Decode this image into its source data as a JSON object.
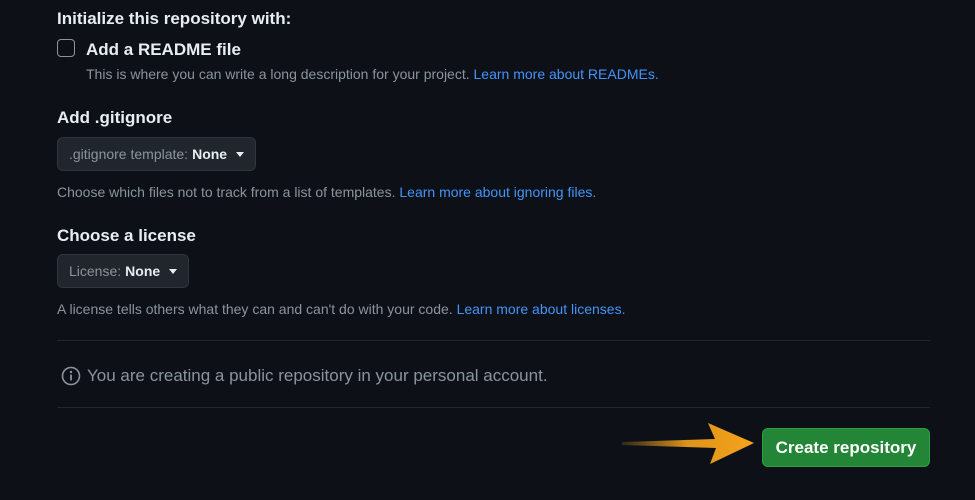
{
  "init": {
    "heading": "Initialize this repository with:",
    "readme_label": "Add a README file",
    "readme_checked": false,
    "readme_help": "This is where you can write a long description for your project.",
    "readme_link": "Learn more about READMEs."
  },
  "gitignore": {
    "heading": "Add .gitignore",
    "select_prefix": ".gitignore template:",
    "select_value": "None",
    "help": "Choose which files not to track from a list of templates.",
    "link": "Learn more about ignoring files."
  },
  "license": {
    "heading": "Choose a license",
    "select_prefix": "License:",
    "select_value": "None",
    "help": "A license tells others what they can and can't do with your code.",
    "link": "Learn more about licenses."
  },
  "notice": {
    "icon": "info-icon",
    "text": "You are creating a public repository in your personal account."
  },
  "actions": {
    "create_label": "Create repository"
  },
  "colors": {
    "background": "#0d1117",
    "link": "#4493f8",
    "primary_button": "#238636",
    "annotation_arrow": "#f5a31a"
  }
}
